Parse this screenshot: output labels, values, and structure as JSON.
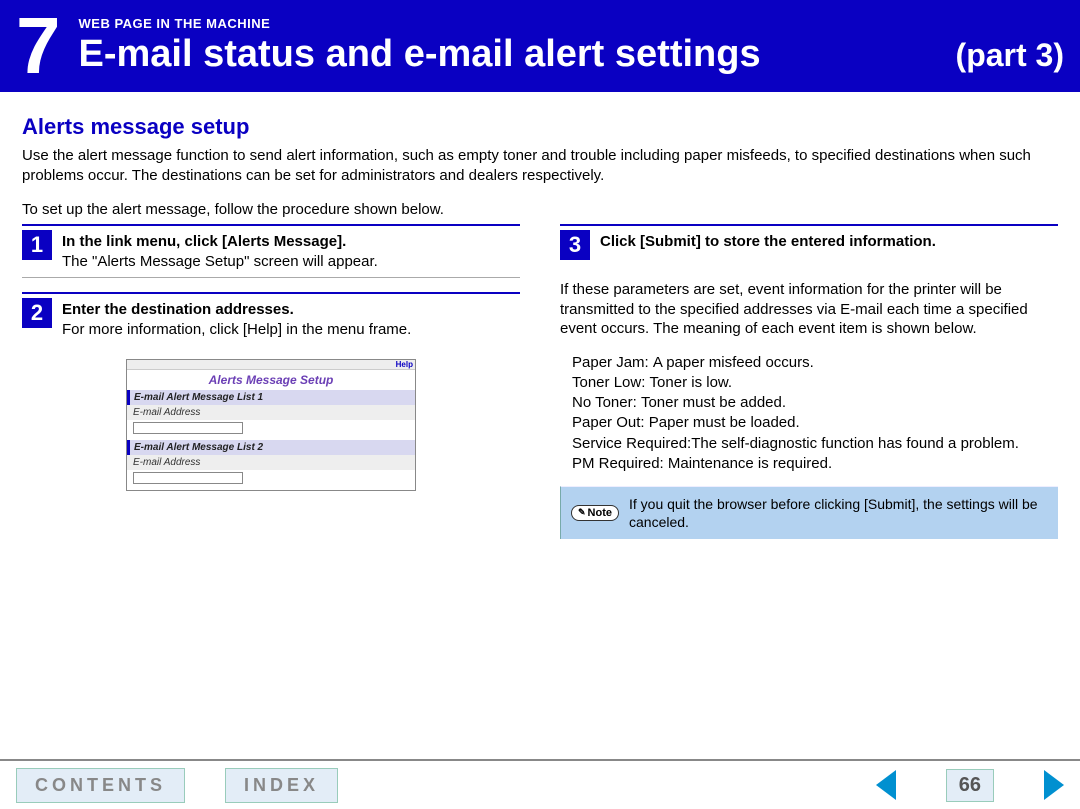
{
  "header": {
    "chapter_number": "7",
    "overline": "WEB PAGE IN THE MACHINE",
    "title": "E-mail status and e-mail alert settings",
    "part": "(part 3)"
  },
  "section": {
    "title": "Alerts message setup",
    "intro": "Use the alert message function to send alert information, such as empty toner and trouble including paper misfeeds, to specified destinations when such problems occur. The destinations can be set for administrators and dealers respectively.",
    "subintro": "To set up the alert message, follow the procedure shown below."
  },
  "steps": {
    "s1": {
      "num": "1",
      "title": "In the link menu, click [Alerts Message].",
      "desc": "The \"Alerts Message Setup\" screen will appear."
    },
    "s2": {
      "num": "2",
      "title": "Enter the destination addresses.",
      "desc": "For more information, click [Help] in the menu frame."
    },
    "s3": {
      "num": "3",
      "title": "Click [Submit] to store the entered information."
    }
  },
  "screenshot": {
    "help": "Help",
    "title": "Alerts Message Setup",
    "group1": "E-mail Alert Message List 1",
    "group2": "E-mail Alert Message List 2",
    "row_label": "E-mail Address"
  },
  "right": {
    "explain": "If these parameters are set, event information for the printer will be transmitted to the specified addresses via E-mail each time a specified event occurs. The meaning of each event item is shown below.",
    "events": {
      "e1": {
        "label": "Paper Jam: ",
        "desc": "A paper misfeed occurs."
      },
      "e2": {
        "label": "Toner Low: ",
        "desc": "Toner is low."
      },
      "e3": {
        "label": "No Toner: ",
        "desc": "Toner must be added."
      },
      "e4": {
        "label": "Paper Out: ",
        "desc": "Paper must be loaded."
      },
      "e5": {
        "label": "Service Required:",
        "desc": "The self-diagnostic function has found a problem."
      },
      "e6": {
        "label": "PM Required: ",
        "desc": "Maintenance is required."
      }
    },
    "note_badge": "Note",
    "note_text": "If you quit the browser before clicking [Submit], the settings will be canceled."
  },
  "footer": {
    "contents": "CONTENTS",
    "index": "INDEX",
    "page": "66"
  }
}
